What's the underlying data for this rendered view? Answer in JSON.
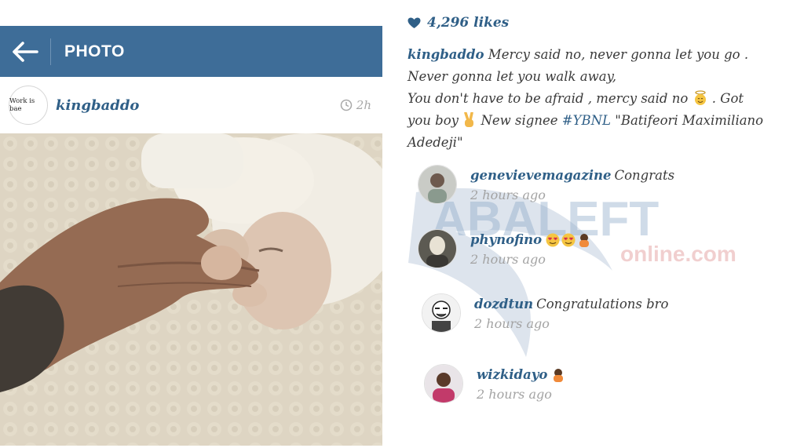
{
  "header": {
    "title": "PHOTO",
    "back_icon": "arrow-left-icon",
    "bg_color": "#3e6d98"
  },
  "post": {
    "avatar_text": "Work is bae",
    "username": "kingbaddo",
    "time": "2h",
    "likes": "4,296 likes",
    "caption": {
      "line1": "Mercy said no, never gonna let you go .",
      "line2": "Never gonna let you walk away,",
      "line3a": "You don't have to be afraid , mercy said no",
      "line3b": ". Got",
      "line4a": "you boy",
      "line4b": "New signee",
      "hashtag": "#YBNL",
      "line4c": "\"Batifeori Maximiliano",
      "line5": "Adedeji\""
    }
  },
  "comments": [
    {
      "username": "genevievemagazine",
      "text": "Congrats",
      "time": "2 hours ago"
    },
    {
      "username": "phynofino",
      "text": "",
      "time": "2 hours ago"
    },
    {
      "username": "dozdtun",
      "text": "Congratulations bro",
      "time": "2 hours ago"
    },
    {
      "username": "wizkidayo",
      "text": "",
      "time": "2 hours ago"
    }
  ],
  "watermark": {
    "text1": "ABALEFT",
    "text2": "online.com"
  },
  "colors": {
    "link": "#2f5f87",
    "meta": "#a3a3a3"
  }
}
